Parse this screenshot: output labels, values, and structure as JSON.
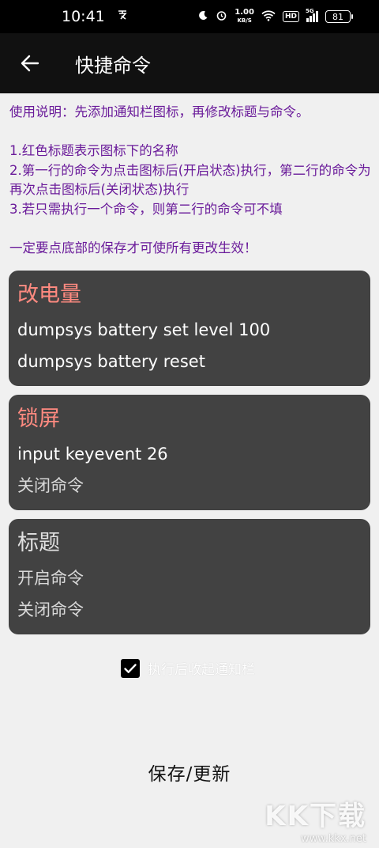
{
  "status_bar": {
    "time": "10:41",
    "net_speed_value": "1.00",
    "net_speed_unit": "KB/S",
    "hd_label": "HD",
    "signal_label": "5G",
    "battery": "81"
  },
  "app_bar": {
    "title": "快捷命令"
  },
  "instructions": {
    "intro": "使用说明：先添加通知栏图标，再修改标题与命令。",
    "line1": "1.红色标题表示图标下的名称",
    "line2": "2.第一行的命令为点击图标后(开启状态)执行，第二行的命令为再次点击图标后(关闭状态)执行",
    "line3": "3.若只需执行一个命令，则第二行的命令可不填",
    "warning": "一定要点底部的保存才可使所有更改生效！"
  },
  "cards": [
    {
      "title": "改电量",
      "cmd_on": "dumpsys battery set level 100",
      "cmd_off": "dumpsys battery reset"
    },
    {
      "title": "锁屏",
      "cmd_on": "input keyevent 26",
      "cmd_off_placeholder": "关闭命令"
    },
    {
      "title_placeholder": "标题",
      "cmd_on_placeholder": "开启命令",
      "cmd_off_placeholder": "关闭命令"
    }
  ],
  "options": {
    "collapse_label": "执行后收起通知栏",
    "collapse_checked": true
  },
  "save_label": "保存/更新",
  "watermark": {
    "logo": "KK下载",
    "url": "www.kkx.net"
  },
  "colors": {
    "accent_purple": "#6a1b9a",
    "title_red": "#ff8a80",
    "card_bg": "#424242"
  }
}
